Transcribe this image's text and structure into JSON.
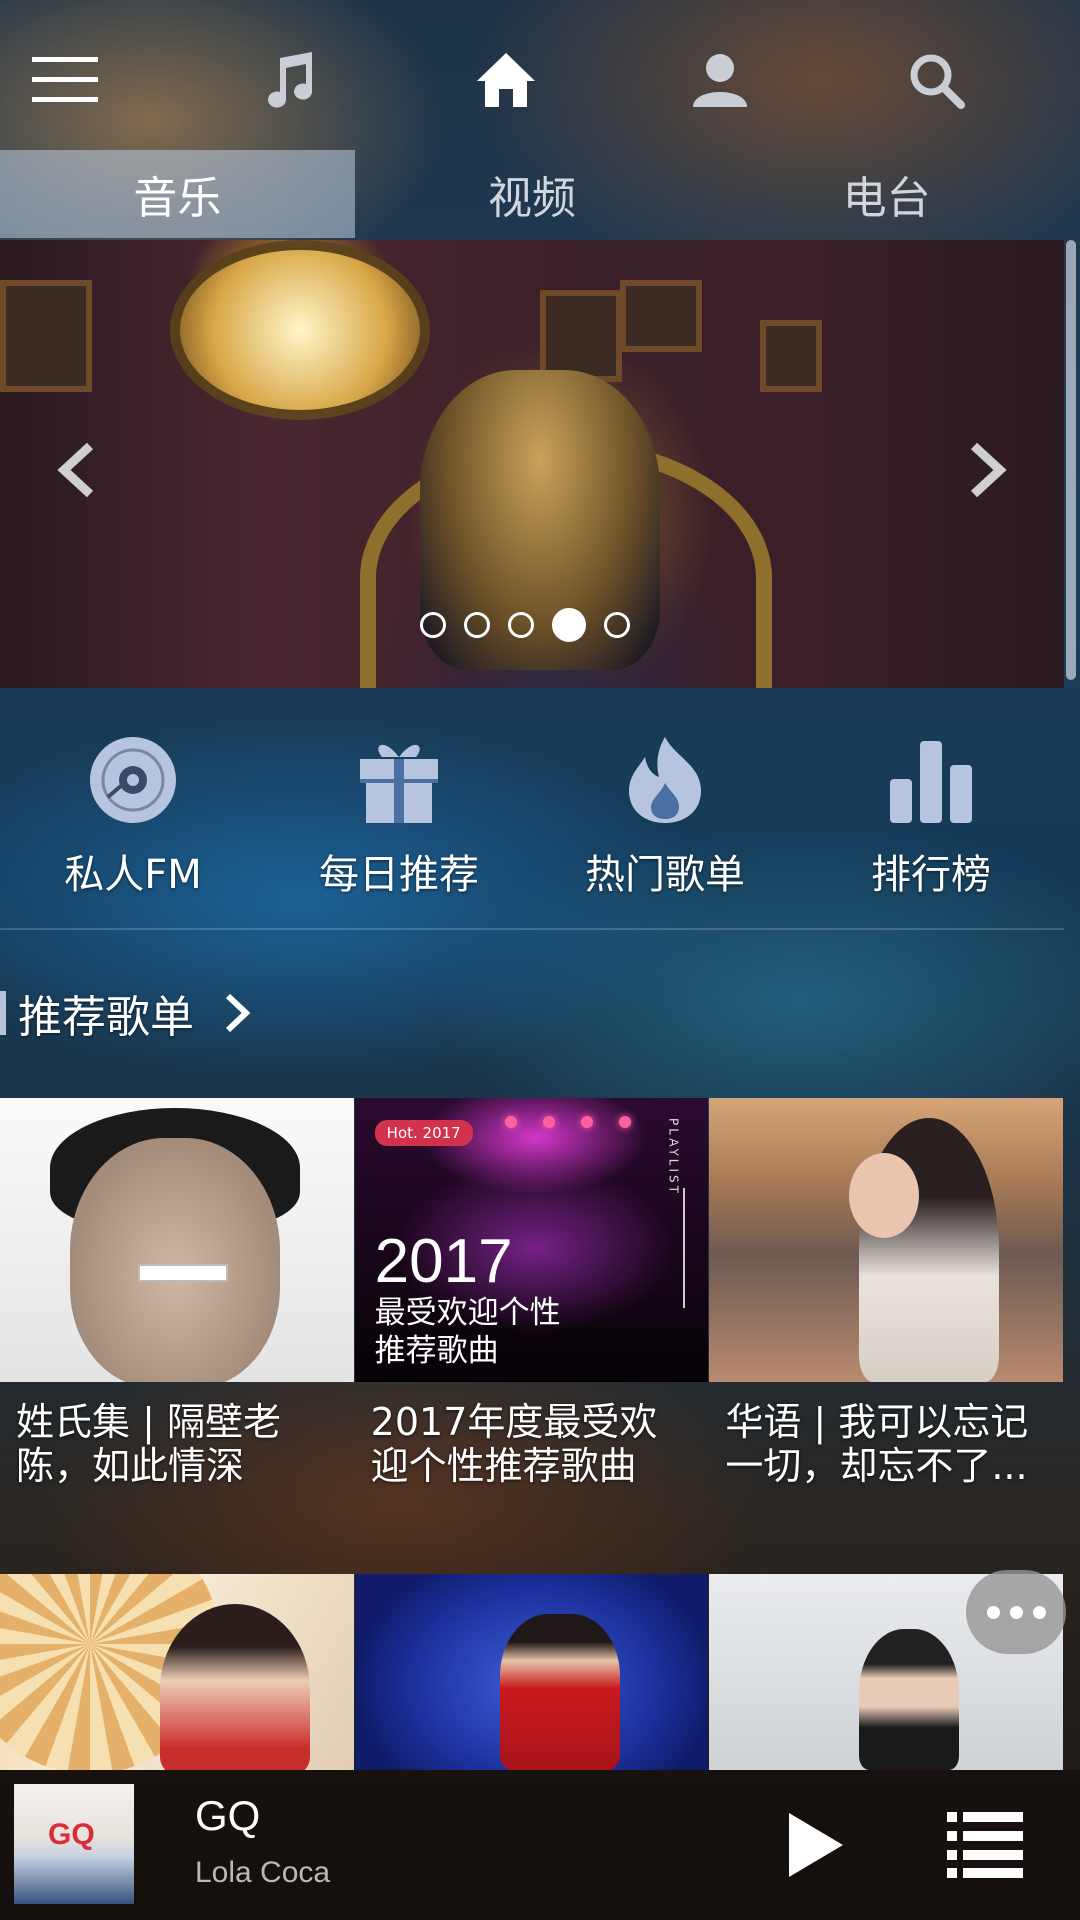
{
  "nav": {
    "menu_icon": "menu-icon",
    "music_icon": "music-note-icon",
    "home_icon": "home-icon",
    "user_icon": "user-icon",
    "search_icon": "search-icon"
  },
  "tabs": [
    {
      "label": "音乐",
      "active": true
    },
    {
      "label": "视频",
      "active": false
    },
    {
      "label": "电台",
      "active": false
    }
  ],
  "banner": {
    "slide_count": 5,
    "active_slide": 4
  },
  "shortcuts": [
    {
      "label": "私人FM",
      "icon": "vinyl-disc-icon"
    },
    {
      "label": "每日推荐",
      "icon": "gift-icon"
    },
    {
      "label": "热门歌单",
      "icon": "flame-icon"
    },
    {
      "label": "排行榜",
      "icon": "bar-chart-icon"
    }
  ],
  "section": {
    "title": "推荐歌单"
  },
  "playlists": [
    {
      "title": "姓氏集 | 隔壁老陈，如此情深"
    },
    {
      "title": "2017年度最受欢迎个性推荐歌曲",
      "cover_badge": "Hot. 2017",
      "cover_year": "2017",
      "cover_line1": "最受欢迎个性",
      "cover_line2": "推荐歌曲",
      "cover_side": "PLAYLIST"
    },
    {
      "title": "华语 | 我可以忘记一切，却忘不了..."
    }
  ],
  "player": {
    "song": "GQ",
    "artist": "Lola Coca",
    "cover_text": "GQ"
  },
  "colors": {
    "tab_active_bg": "#bccde1",
    "icon_tint": "#b7c4df"
  }
}
